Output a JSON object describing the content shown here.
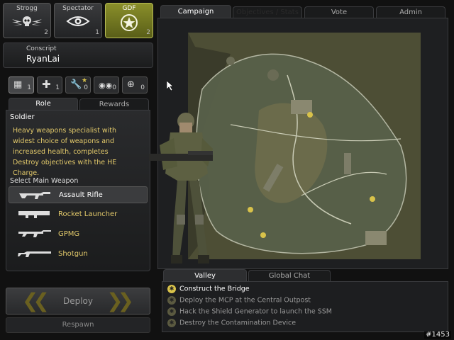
{
  "teams": [
    {
      "name": "Strogg",
      "count": "2",
      "icon": "skull-wings-icon"
    },
    {
      "name": "Spectator",
      "count": "1",
      "icon": "eye-icon"
    },
    {
      "name": "GDF",
      "count": "2",
      "icon": "gdf-star-icon"
    }
  ],
  "player": {
    "rank": "Conscript",
    "name": "RyanLai"
  },
  "classes": [
    {
      "icon": "soldier-icon",
      "count": "1"
    },
    {
      "icon": "medic-cross-icon",
      "count": "1"
    },
    {
      "icon": "engineer-wrench-icon",
      "count": "0"
    },
    {
      "icon": "binoculars-icon",
      "count": "0"
    },
    {
      "icon": "crosshair-icon",
      "count": "0"
    }
  ],
  "left_tabs": {
    "role": "Role",
    "rewards": "Rewards"
  },
  "role": {
    "title": "Soldier",
    "description": "Heavy weapons specialist with widest choice of weapons and increased health, completes Destroy objectives with the HE Charge.",
    "select_label": "Select Main Weapon"
  },
  "weapons": [
    "Assault Rifle",
    "Rocket Launcher",
    "GPMG",
    "Shotgun"
  ],
  "buttons": {
    "deploy": "Deploy",
    "respawn": "Respawn"
  },
  "top_tabs": [
    "Campaign",
    "Objectives / Stats",
    "Vote",
    "Admin"
  ],
  "map_tabs": {
    "valley": "Valley",
    "chat": "Global Chat"
  },
  "objectives": [
    "Construct the Bridge",
    "Deploy the MCP at the Central Outpost",
    "Hack the Shield Generator to launch the SSM",
    "Destroy the Contamination Device"
  ],
  "screenshot_id": "#1453",
  "colors": {
    "accent_gold": "#d8c24a",
    "gdf_active": "#8a8f2a"
  }
}
